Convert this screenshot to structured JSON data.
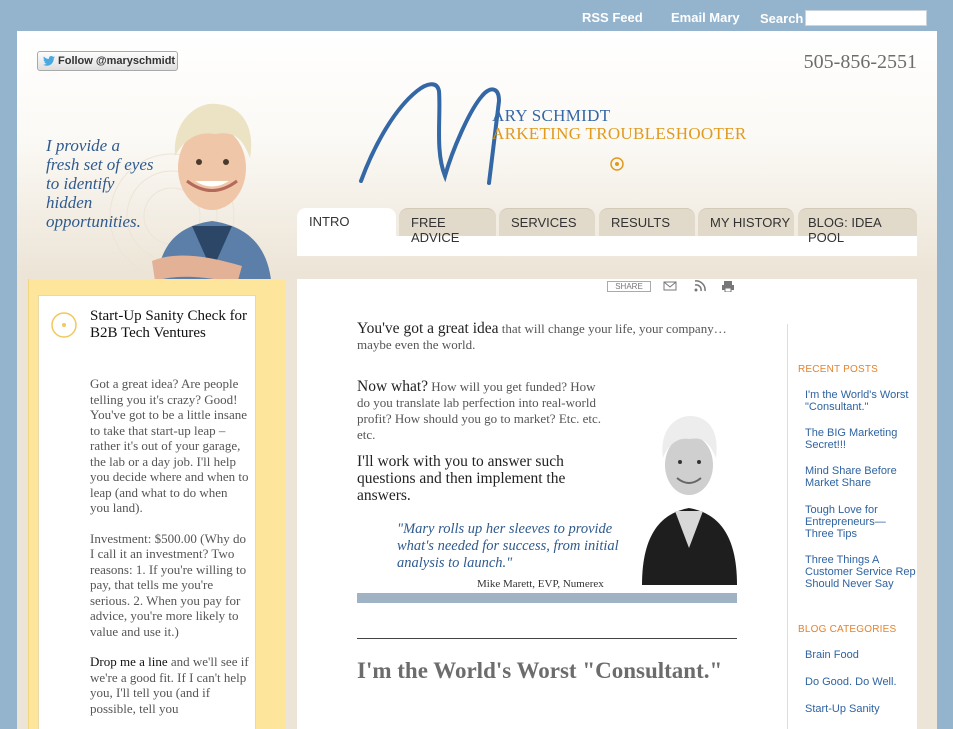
{
  "topbar": {
    "rss": "RSS Feed",
    "email": "Email Mary",
    "search_label": "Search",
    "search_value": ""
  },
  "header": {
    "follow_label": "Follow @maryschmidt",
    "phone": "505-856-2551",
    "tagline": "I provide a fresh set of eyes to identify hidden opportunities.",
    "logo_line1": "ARY SCHMIDT",
    "logo_line2": "ARKETING TROUBLESHOOTER",
    "logo_letter": "M"
  },
  "nav": {
    "tabs": [
      {
        "label": "INTRO"
      },
      {
        "label": "FREE ADVICE"
      },
      {
        "label": "SERVICES"
      },
      {
        "label": "RESULTS"
      },
      {
        "label": "MY HISTORY"
      },
      {
        "label": "BLOG: IDEA POOL"
      }
    ]
  },
  "sidebar": {
    "title": "Start-Up Sanity Check for B2B Tech Ventures",
    "p1": "Got a great idea? Are people telling you it's crazy? Good! You've got to be a little insane to take that start-up leap – rather it's out of your garage, the lab or a day job. I'll help you decide where and when to leap (and what to do when you land).",
    "p2": "Investment: $500.00 (Why do I call it an investment? Two reasons: 1. If you're willing to pay, that tells me you're serious. 2. When you pay for advice, you're more likely to value and use it.)",
    "p3_link": "Drop me a line",
    "p3_rest": " and we'll see if we're a good fit. If I can't help you, I'll tell you (and if possible, tell you"
  },
  "toolbar": {
    "share": "SHARE"
  },
  "main": {
    "intro1_big": "You've got a great idea",
    "intro1_rest": " that will change your life, your company…maybe even the world.",
    "intro2_big": "Now what?",
    "intro2_rest": " How will you get funded? How do you translate lab perfection into real-world profit? How should you go to market? Etc. etc. etc.",
    "intro3": "I'll work with you to answer such questions and then implement the answers.",
    "quote": "\"Mary rolls up her sleeves to provide what's needed for success, from initial analysis to launch.\"",
    "quote_attr": "Mike Marett, EVP, Numerex",
    "post_title": "I'm the World's Worst \"Consultant.\""
  },
  "right": {
    "recent_head": "RECENT POSTS",
    "recent": [
      "I'm the World's Worst \"Consultant.\"",
      "The BIG Marketing Secret!!!",
      "Mind Share Before Market Share",
      "Tough Love for Entrepreneurs— Three Tips",
      "Three Things A Customer Service Rep Should Never Say"
    ],
    "cat_head": "BLOG CATEGORIES",
    "categories": [
      "Brain Food",
      "Do Good. Do Well.",
      "Start-Up Sanity"
    ]
  },
  "colors": {
    "background": "#94b3cc",
    "accent_blue": "#2f5a8d",
    "accent_orange": "#e5822b",
    "sidebar_yellow": "#fde69b"
  }
}
